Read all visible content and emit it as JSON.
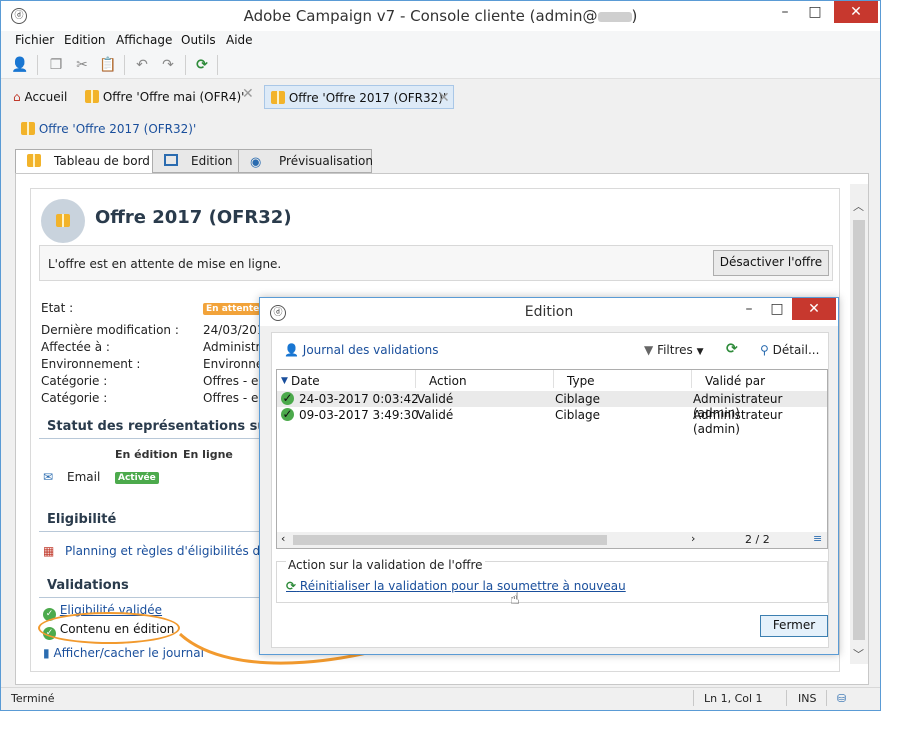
{
  "window": {
    "title": "Adobe Campaign v7 - Console cliente (admin@",
    "title_end": ")"
  },
  "menu": [
    "Fichier",
    "Edition",
    "Affichage",
    "Outils",
    "Aide"
  ],
  "doc_tabs": [
    {
      "label": "Accueil"
    },
    {
      "label": "Offre 'Offre mai (OFR4)'"
    },
    {
      "label": "Offre 'Offre 2017 (OFR32)'"
    }
  ],
  "breadcrumb": "Offre 'Offre 2017 (OFR32)'",
  "panel_tabs": [
    {
      "label": "Tableau de bord"
    },
    {
      "label": "Edition"
    },
    {
      "label": "Prévisualisation"
    }
  ],
  "offer": {
    "title": "Offre 2017 (OFR32)",
    "notice": "L'offre est en attente de mise en ligne.",
    "deactivate_button": "Désactiver l'offre",
    "props": [
      {
        "label": "Etat :",
        "value": ""
      },
      {
        "label": "Dernière modification :",
        "value": "24/03/201"
      },
      {
        "label": "Affectée à :",
        "value": "Administra"
      },
      {
        "label": "Environnement :",
        "value": "Environne"
      },
      {
        "label": "Catégorie :",
        "value": "Offres - en"
      },
      {
        "label": "Catégorie :",
        "value": "Offres - en"
      }
    ],
    "status_badge": "En attente",
    "representations": {
      "title": "Statut des représentations sur le",
      "col_edit": "En édition",
      "col_online": "En ligne",
      "channel": "Email",
      "channel_status": "Activée"
    },
    "eligibility": {
      "title": "Eligibilité",
      "link": "Planning et règles d'éligibilités de"
    },
    "validations": {
      "title": "Validations",
      "items": [
        "Eligibilité validée",
        "Contenu en édition"
      ],
      "log_link": "Afficher/cacher le journal"
    }
  },
  "dialog": {
    "title": "Edition",
    "journal_label": "Journal des validations",
    "filters_label": "Filtres",
    "detail_label": "Détail...",
    "columns": [
      "Date",
      "Action",
      "Type",
      "Validé par"
    ],
    "rows": [
      [
        "24-03-2017 0:03:42",
        "Validé",
        "Ciblage",
        "Administrateur (admin)"
      ],
      [
        "09-03-2017 3:49:30",
        "Validé",
        "Ciblage",
        "Administrateur (admin)"
      ]
    ],
    "pager": "2 / 2",
    "action_group": "Action sur la validation de l'offre",
    "reset_link": "Réinitialiser la validation pour la soumettre à nouveau",
    "close_button": "Fermer"
  },
  "status": {
    "text": "Terminé",
    "position": "Ln 1, Col 1",
    "mode": "INS"
  },
  "colors": {
    "accent_orange": "#f29a2e",
    "link_blue": "#1a4f9c",
    "success_green": "#4caa4c",
    "close_red": "#c7382e"
  }
}
